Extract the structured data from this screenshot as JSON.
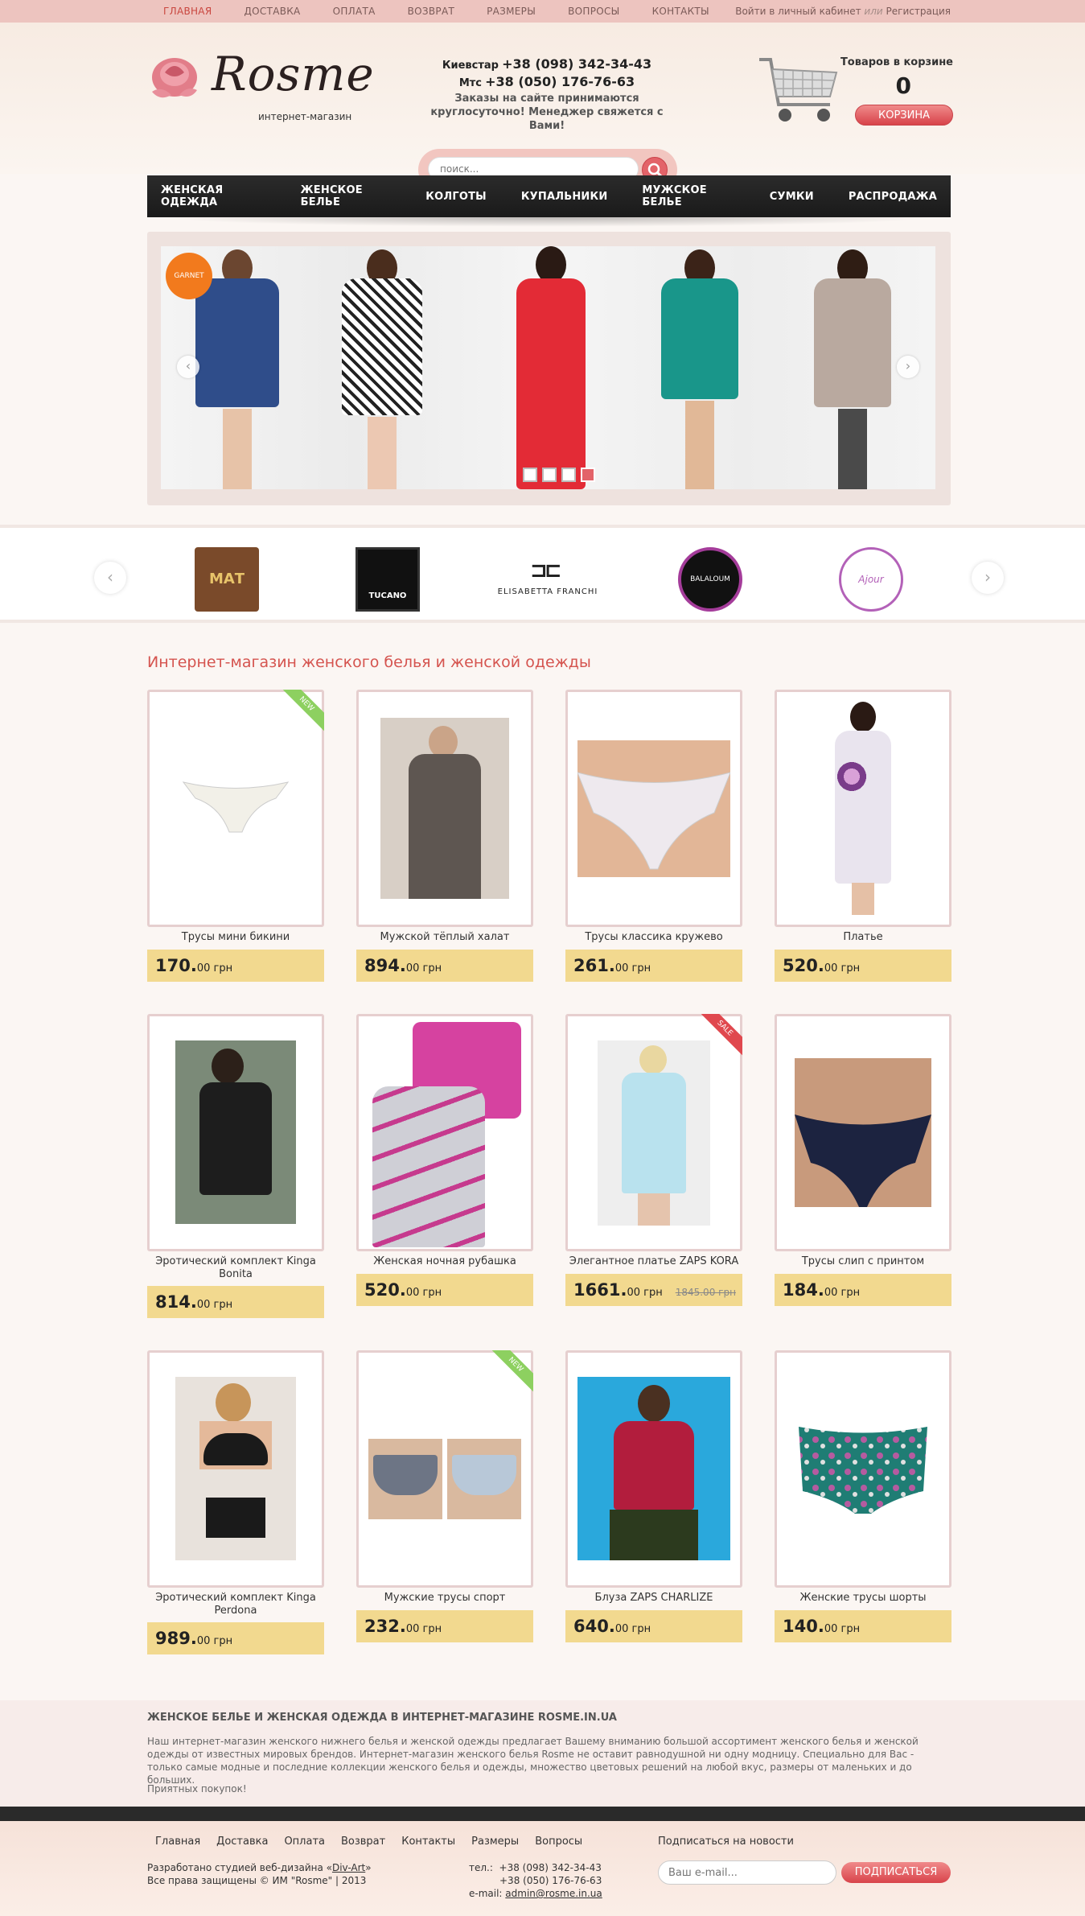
{
  "topbar": {
    "menu": [
      "ГЛАВНАЯ",
      "ДОСТАВКА",
      "ОПЛАТА",
      "ВОЗВРАТ",
      "РАЗМЕРЫ",
      "ВОПРОСЫ",
      "КОНТАКТЫ"
    ],
    "login": "Войти в личный кабинет",
    "or": "или",
    "register": "Регистрация"
  },
  "logo": {
    "name": "Rosme",
    "subtitle": "интернет-магазин"
  },
  "contacts": {
    "line1_label": "Киевстар",
    "line1_phone": "+38 (098) 342-34-43",
    "line2_label": "Мтс",
    "line2_phone": "+38 (050) 176-76-63",
    "note1": "Заказы на сайте принимаются",
    "note2": "круглосуточно!  Менеджер свяжется с Вами!"
  },
  "cart": {
    "label": "Товаров в корзине",
    "count": "0",
    "button": "КОРЗИНА"
  },
  "search": {
    "placeholder": "поиск..."
  },
  "nav": [
    "ЖЕНСКАЯ ОДЕЖДА",
    "ЖЕНСКОЕ БЕЛЬЕ",
    "КОЛГОТЫ",
    "КУПАЛЬНИКИ",
    "МУЖСКОЕ БЕЛЬЕ",
    "СУМКИ",
    "РАСПРОДАЖА"
  ],
  "slider": {
    "badge": "GARNET",
    "dots": 4,
    "active_dot": 4
  },
  "brands": [
    "МАТ",
    "TUCANO",
    "ELISABETTA FRANCHI",
    "BALALOUM",
    "Ajour"
  ],
  "section_title": "Интернет-магазин женского белья и женской одежды",
  "products": [
    {
      "title": "Трусы мини бикини",
      "price_big": "170.",
      "price_small": "00 грн",
      "ribbon": "NEW"
    },
    {
      "title": "Мужской тёплый халат",
      "price_big": "894.",
      "price_small": "00 грн"
    },
    {
      "title": "Трусы классика кружево",
      "price_big": "261.",
      "price_small": "00 грн"
    },
    {
      "title": "Платье",
      "price_big": "520.",
      "price_small": "00 грн"
    },
    {
      "title": "Эротический комплект Kinga Bonita",
      "price_big": "814.",
      "price_small": "00 грн"
    },
    {
      "title": "Женская ночная рубашка",
      "price_big": "520.",
      "price_small": "00 грн"
    },
    {
      "title": "Элегантное платье ZAPS KORA",
      "price_big": "1661.",
      "price_small": "00 грн",
      "old_price": "1845.00 грн",
      "ribbon": "SALE"
    },
    {
      "title": "Трусы слип с принтом",
      "price_big": "184.",
      "price_small": "00 грн"
    },
    {
      "title": "Эротический комплект Kinga Perdona",
      "price_big": "989.",
      "price_small": "00 грн"
    },
    {
      "title": "Мужские трусы спорт",
      "price_big": "232.",
      "price_small": "00 грн",
      "ribbon": "NEW"
    },
    {
      "title": "Блуза ZAPS CHARLIZE",
      "price_big": "640.",
      "price_small": "00 грн"
    },
    {
      "title": "Женские трусы шорты",
      "price_big": "140.",
      "price_small": "00 грн"
    }
  ],
  "seo": {
    "heading": "ЖЕНСКОЕ БЕЛЬЕ И ЖЕНСКАЯ ОДЕЖДА В ИНТЕРНЕТ-МАГАЗИНЕ ROSME.IN.UA",
    "text": "Наш интернет-магазин женского нижнего белья и женской одежды предлагает Вашему вниманию большой ассортимент женского белья и женской одежды от известных мировых брендов. Интернет-магазин женского белья Rosme не оставит равнодушной ни одну модницу. Специально для Вас - только самые модные и последние коллекции женского белья и одежды, множество цветовых решений на любой вкус, размеры от маленьких и до больших.",
    "closing": "Приятных покупок!"
  },
  "footer": {
    "menu": [
      "Главная",
      "Доставка",
      "Оплата",
      "Возврат",
      "Контакты",
      "Размеры",
      "Вопросы"
    ],
    "dev_prefix": "Разработано студией веб-дизайна «",
    "dev_link": "Div-Art",
    "dev_suffix": "»",
    "rights": "Все права защищены © ИМ \"Rosme\" | 2013",
    "tel_label": "тел.:",
    "tel1": "+38 (098) 342-34-43",
    "tel2": "+38 (050) 176-76-63",
    "email_label": "e-mail:",
    "email": "admin@rosme.in.ua",
    "subscribe_label": "Подписаться на новости",
    "email_placeholder": "Ваш e-mail...",
    "subscribe_button": "ПОДПИСАТЬСЯ"
  },
  "colors": {
    "accent": "#d8434a",
    "topbar": "#edc4bf",
    "price_bg": "#f2d98f",
    "nav_bg": "#1f1f1f"
  }
}
